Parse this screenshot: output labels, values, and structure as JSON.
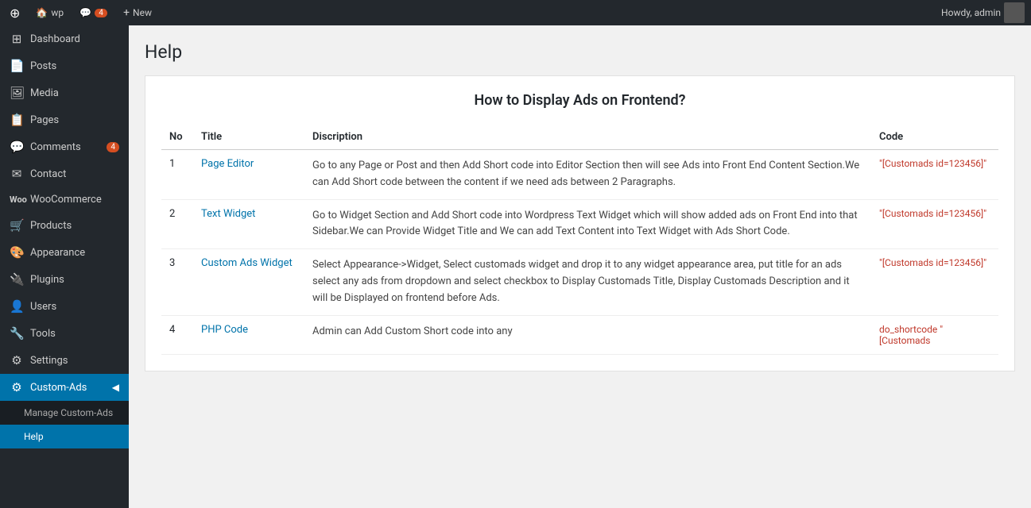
{
  "adminBar": {
    "wpIcon": "W",
    "siteName": "wp",
    "commentsCount": "4",
    "newLabel": "New",
    "howdyLabel": "Howdy, admin"
  },
  "sidebar": {
    "items": [
      {
        "id": "dashboard",
        "label": "Dashboard",
        "icon": "⊞"
      },
      {
        "id": "posts",
        "label": "Posts",
        "icon": "📄"
      },
      {
        "id": "media",
        "label": "Media",
        "icon": "🖼"
      },
      {
        "id": "pages",
        "label": "Pages",
        "icon": "📋"
      },
      {
        "id": "comments",
        "label": "Comments",
        "icon": "💬",
        "badge": "4"
      },
      {
        "id": "contact",
        "label": "Contact",
        "icon": "✉"
      },
      {
        "id": "woocommerce",
        "label": "WooCommerce",
        "icon": "Woo"
      },
      {
        "id": "products",
        "label": "Products",
        "icon": "🛒"
      },
      {
        "id": "appearance",
        "label": "Appearance",
        "icon": "🎨"
      },
      {
        "id": "plugins",
        "label": "Plugins",
        "icon": "🔌"
      },
      {
        "id": "users",
        "label": "Users",
        "icon": "👤"
      },
      {
        "id": "tools",
        "label": "Tools",
        "icon": "🔧"
      },
      {
        "id": "settings",
        "label": "Settings",
        "icon": "⚙"
      },
      {
        "id": "custom-ads",
        "label": "Custom-Ads",
        "icon": "⚙"
      }
    ],
    "submenu": [
      {
        "id": "manage-custom-ads",
        "label": "Manage Custom-Ads"
      },
      {
        "id": "help",
        "label": "Help"
      }
    ]
  },
  "page": {
    "title": "Help",
    "heading": "How to Display Ads on Frontend?",
    "tableHeaders": {
      "no": "No",
      "title": "Title",
      "description": "Discription",
      "code": "Code"
    },
    "rows": [
      {
        "no": "1",
        "title": "Page Editor",
        "description": "Go to any Page or Post and then Add Short code into Editor Section then will see Ads into Front End Content Section.We can Add Short code between the content if we need ads between 2 Paragraphs.",
        "code": "\"[Customads id=123456]\""
      },
      {
        "no": "2",
        "title": "Text Widget",
        "description": "Go to Widget Section and Add Short code into Wordpress Text Widget which will show added ads on Front End into that Sidebar.We can Provide Widget Title and We can add Text Content into Text Widget with Ads Short Code.",
        "code": "\"[Customads id=123456]\""
      },
      {
        "no": "3",
        "title": "Custom Ads Widget",
        "description": "Select Appearance->Widget, Select customads widget and drop it to any widget appearance area, put title for an ads select any ads from dropdown and select checkbox to Display Customads Title, Display Customads Description and it will be Displayed on frontend before Ads.",
        "code": "\"[Customads id=123456]\""
      },
      {
        "no": "4",
        "title": "PHP Code",
        "description": "Admin can Add Custom Short code into any",
        "code": "do_shortcode \"[Customads"
      }
    ]
  }
}
